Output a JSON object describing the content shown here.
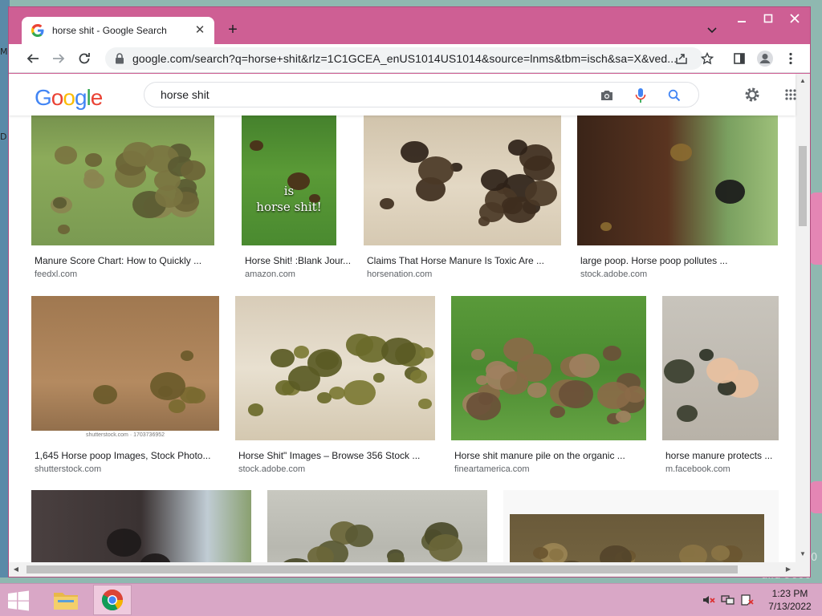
{
  "desktop": {
    "edge_marks": [
      "M",
      "D"
    ],
    "watermark_line1": "0",
    "watermark_line2": "uild 9600"
  },
  "browser": {
    "tab": {
      "title": "horse shit - Google Search"
    },
    "url": "google.com/search?q=horse+shit&rlz=1C1GCEA_enUS1014US1014&source=lnms&tbm=isch&sa=X&ved..."
  },
  "google": {
    "logo_letters": [
      {
        "ch": "G",
        "color": "#4285F4"
      },
      {
        "ch": "o",
        "color": "#EA4335"
      },
      {
        "ch": "o",
        "color": "#FBBC05"
      },
      {
        "ch": "g",
        "color": "#4285F4"
      },
      {
        "ch": "l",
        "color": "#34A853"
      },
      {
        "ch": "e",
        "color": "#EA4335"
      }
    ],
    "query": "horse shit"
  },
  "results": [
    {
      "caption": "Manure Score Chart: How to Quickly ...",
      "source": "feedxl.com"
    },
    {
      "caption": "Horse Shit! :Blank Jour...",
      "source": "amazon.com",
      "overlay": [
        "is",
        "horse shit!"
      ]
    },
    {
      "caption": "Claims That Horse Manure Is Toxic Are ...",
      "source": "horsenation.com"
    },
    {
      "caption": "large poop. Horse poop pollutes ...",
      "source": "stock.adobe.com"
    },
    {
      "caption": "1,645 Horse poop Images, Stock Photo...",
      "source": "shutterstock.com",
      "overlay": [
        "shutterstock.com · 1703736952"
      ]
    },
    {
      "caption": "Horse Shit\" Images – Browse 356 Stock ...",
      "source": "stock.adobe.com"
    },
    {
      "caption": "Horse shit manure pile on the organic ...",
      "source": "fineartamerica.com"
    },
    {
      "caption": "horse manure protects ...",
      "source": "m.facebook.com"
    },
    {
      "caption": "",
      "source": ""
    },
    {
      "caption": "",
      "source": ""
    },
    {
      "caption": "",
      "source": ""
    }
  ],
  "taskbar": {
    "time": "1:23 PM",
    "date": "7/13/2022"
  },
  "colors": {
    "window_frame": "#ce5f94",
    "taskbar": "#d9a7c6",
    "google_blue": "#4285F4"
  },
  "icons": [
    "google-favicon",
    "close-tab-icon",
    "new-tab-icon",
    "tab-search-icon",
    "minimize-icon",
    "maximize-icon",
    "close-window-icon",
    "back-icon",
    "forward-icon",
    "reload-icon",
    "lock-icon",
    "share-icon",
    "star-icon",
    "sidebar-icon",
    "profile-icon",
    "more-icon",
    "camera-icon",
    "mic-icon",
    "search-icon",
    "settings-icon",
    "apps-icon",
    "windows-start-icon",
    "file-explorer-icon",
    "chrome-icon",
    "volume-muted-icon",
    "network-icon",
    "action-center-icon"
  ]
}
